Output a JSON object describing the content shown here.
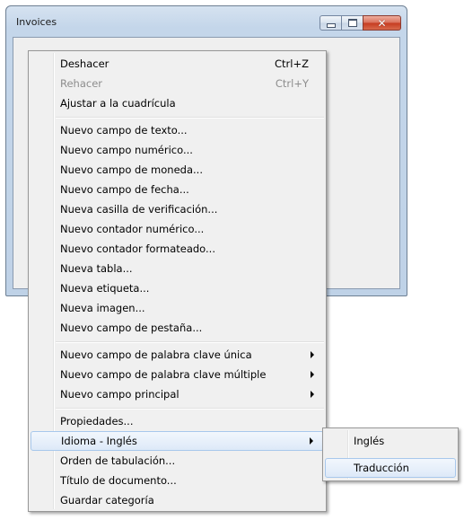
{
  "window": {
    "title": "Invoices",
    "controls": [
      "minimize-icon",
      "maximize-icon",
      "close-icon"
    ]
  },
  "context_menu": {
    "items": [
      {
        "label": "Deshacer",
        "shortcut": "Ctrl+Z",
        "enabled": true
      },
      {
        "label": "Rehacer",
        "shortcut": "Ctrl+Y",
        "enabled": false
      },
      {
        "label": "Ajustar a la cuadrícula",
        "shortcut": "",
        "enabled": true
      },
      {
        "label": "Nuevo campo de texto...",
        "shortcut": "",
        "enabled": true
      },
      {
        "label": "Nuevo campo numérico...",
        "shortcut": "",
        "enabled": true
      },
      {
        "label": "Nuevo campo de moneda...",
        "shortcut": "",
        "enabled": true
      },
      {
        "label": "Nuevo campo de fecha...",
        "shortcut": "",
        "enabled": true
      },
      {
        "label": "Nueva casilla de verificación...",
        "shortcut": "",
        "enabled": true
      },
      {
        "label": "Nuevo contador numérico...",
        "shortcut": "",
        "enabled": true
      },
      {
        "label": "Nuevo contador formateado...",
        "shortcut": "",
        "enabled": true
      },
      {
        "label": "Nueva tabla...",
        "shortcut": "",
        "enabled": true
      },
      {
        "label": "Nueva etiqueta...",
        "shortcut": "",
        "enabled": true
      },
      {
        "label": "Nueva imagen...",
        "shortcut": "",
        "enabled": true
      },
      {
        "label": "Nuevo campo de pestaña...",
        "shortcut": "",
        "enabled": true
      },
      {
        "label": "Nuevo campo de palabra clave única",
        "submenu": true,
        "enabled": true
      },
      {
        "label": "Nuevo campo de palabra clave múltiple",
        "submenu": true,
        "enabled": true
      },
      {
        "label": "Nuevo campo principal",
        "submenu": true,
        "enabled": true
      },
      {
        "label": "Propiedades...",
        "shortcut": "",
        "enabled": true
      },
      {
        "label": "Idioma - Inglés",
        "submenu": true,
        "enabled": true,
        "highlighted": true
      },
      {
        "label": "Orden de tabulación...",
        "shortcut": "",
        "enabled": true
      },
      {
        "label": "Título de documento...",
        "shortcut": "",
        "enabled": true
      },
      {
        "label": "Guardar categoría",
        "shortcut": "",
        "enabled": true
      }
    ]
  },
  "language_submenu": {
    "items": [
      {
        "label": "Inglés",
        "highlighted": false
      },
      {
        "label": "Traducción",
        "highlighted": true
      }
    ]
  },
  "colors": {
    "menu_background": "#f0f0f0",
    "highlight_border": "#a8c8ec",
    "disabled_text": "#8d8d8d",
    "close_button": "#c53b20"
  }
}
